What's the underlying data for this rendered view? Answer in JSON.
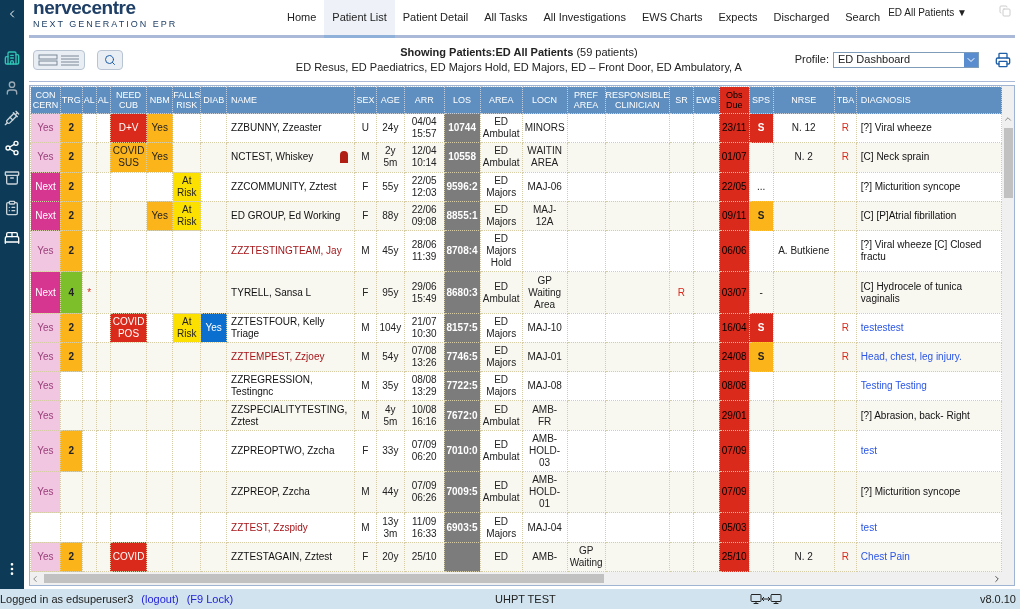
{
  "logo": {
    "name": "nervecentre",
    "tagline": "NEXT GENERATION EPR"
  },
  "nav": [
    {
      "label": "Home",
      "selected": false
    },
    {
      "label": "Patient List",
      "selected": true
    },
    {
      "label": "Patient Detail",
      "selected": false
    },
    {
      "label": "All Tasks",
      "selected": false
    },
    {
      "label": "All Investigations",
      "selected": false
    },
    {
      "label": "EWS Charts",
      "selected": false
    },
    {
      "label": "Expects",
      "selected": false
    },
    {
      "label": "Discharged",
      "selected": false
    },
    {
      "label": "Search",
      "selected": false
    }
  ],
  "list_selector": "ED All Patients ▼",
  "summary": {
    "title": "**Showing Patients:ED All Patients** (59 patients)",
    "areas": "ED Resus, ED Paediatrics, ED Majors Hold, ED Majors, ED – Front Door, ED Ambulatory, A"
  },
  "profile": {
    "label": "Profile:",
    "value": "ED Dashboard"
  },
  "columns": [
    {
      "label": "CON\nCERN"
    },
    {
      "label": "TRG"
    },
    {
      "label": "AL"
    },
    {
      "label": "AL"
    },
    {
      "label": "NEED\nCUB"
    },
    {
      "label": "NBM"
    },
    {
      "label": "FALLS\nRISK"
    },
    {
      "label": "DIAB"
    },
    {
      "label": "NAME",
      "kind": "left"
    },
    {
      "label": "SEX"
    },
    {
      "label": "AGE"
    },
    {
      "label": "ARR"
    },
    {
      "label": "LOS",
      "kind": "shaded"
    },
    {
      "label": "AREA"
    },
    {
      "label": "LOCN"
    },
    {
      "label": "PREF\nAREA"
    },
    {
      "label": "RESPONSIBLE\nCLINICIAN"
    },
    {
      "label": "SR"
    },
    {
      "label": "EWS"
    },
    {
      "label": "Obs\nDue",
      "kind": "alert"
    },
    {
      "label": "SPS"
    },
    {
      "label": "NRSE"
    },
    {
      "label": "TBA"
    },
    {
      "label": "DIAGNOSIS",
      "kind": "left"
    }
  ],
  "rows": [
    {
      "cells": [
        {
          "text": "Yes",
          "color": "#f0c6e0"
        },
        {
          "text": "2",
          "color": "#fbb41a"
        },
        null,
        null,
        {
          "text": "D+V",
          "color": "#d92a1c"
        },
        {
          "text": "Yes",
          "color": "#fbb41a"
        },
        null,
        null,
        {
          "text": "ZZBUNNY, Zzeaster"
        },
        "U",
        "24y",
        "04/04\n15:57",
        "10744",
        "ED\nAmbulat",
        "MINORS",
        null,
        null,
        null,
        null,
        "23/11",
        {
          "text": "S",
          "color": "#d92a1c"
        },
        "N. 12",
        {
          "text": "R",
          "kind": "flag"
        },
        {
          "text": "[?] Viral wheeze"
        }
      ]
    },
    {
      "cells": [
        {
          "text": "Yes",
          "color": "#f0c6e0"
        },
        {
          "text": "2",
          "color": "#fbb41a"
        },
        null,
        null,
        {
          "text": "COVID\nSUS",
          "color": "#fbb41a"
        },
        {
          "text": "Yes",
          "color": "#fbb41a"
        },
        null,
        null,
        {
          "text": "NCTEST, Whiskey",
          "query": true
        },
        "M",
        "2y\n5m",
        "12/04\n10:14",
        "10558",
        "ED\nAmbulat",
        "WAITIN\nAREA",
        null,
        null,
        null,
        null,
        "01/07",
        null,
        "N. 2",
        {
          "text": "R",
          "kind": "flag"
        },
        {
          "text": "[C] Neck sprain"
        }
      ]
    },
    {
      "cells": [
        {
          "text": "Next",
          "color": "#d6368f"
        },
        {
          "text": "2",
          "color": "#fbb41a"
        },
        null,
        null,
        null,
        null,
        {
          "text": "At\nRisk",
          "color": "#fbe000"
        },
        null,
        {
          "text": "ZZCOMMUNITY, Zztest"
        },
        "F",
        "55y",
        "22/05\n12:03",
        "9596:2",
        "ED\nMajors",
        "MAJ-06",
        null,
        null,
        null,
        null,
        "22/05",
        "...",
        null,
        null,
        {
          "text": "[?] Micturition syncope"
        }
      ]
    },
    {
      "cells": [
        {
          "text": "Next",
          "color": "#d6368f"
        },
        {
          "text": "2",
          "color": "#fbb41a"
        },
        null,
        null,
        null,
        {
          "text": "Yes",
          "color": "#fbb41a"
        },
        {
          "text": "At\nRisk",
          "color": "#fbe000"
        },
        null,
        {
          "text": "ED GROUP, Ed Working"
        },
        "F",
        "88y",
        "22/06\n09:08",
        "8855:1",
        "ED\nMajors",
        "MAJ-\n12A",
        null,
        null,
        null,
        null,
        "09/11",
        {
          "text": "S",
          "color": "#fbb41a"
        },
        null,
        null,
        {
          "text": "[C] [P]Atrial fibrillation"
        }
      ]
    },
    {
      "cells": [
        {
          "text": "Yes",
          "color": "#f0c6e0"
        },
        {
          "text": "2",
          "color": "#fbb41a"
        },
        null,
        null,
        null,
        null,
        null,
        null,
        {
          "text": "ZZZTESTINGTEAM, Jay",
          "color": "#a4161a"
        },
        "M",
        "45y",
        "28/06\n11:39",
        "8708:4",
        "ED\nMajors\nHold",
        null,
        null,
        null,
        null,
        null,
        "06/06",
        null,
        "A. Butkiene",
        null,
        {
          "text": "[?] Viral wheeze [C] Closed fractu"
        }
      ]
    },
    {
      "cells": [
        {
          "text": "Next",
          "color": "#d6368f"
        },
        {
          "text": "4",
          "color": "#7cbf2a"
        },
        {
          "text": "*",
          "kind": "flag"
        },
        null,
        null,
        null,
        null,
        null,
        {
          "text": "TYRELL, Sansa L"
        },
        "F",
        "95y",
        "29/06\n15:49",
        "8680:3",
        "ED\nAmbulat",
        "GP\nWaiting\nArea",
        null,
        null,
        {
          "text": "R",
          "kind": "flag"
        },
        null,
        "03/07",
        "-",
        null,
        null,
        {
          "text": "[C] Hydrocele of tunica vaginalis"
        }
      ]
    },
    {
      "cells": [
        {
          "text": "Yes",
          "color": "#f0c6e0"
        },
        {
          "text": "2",
          "color": "#fbb41a"
        },
        null,
        null,
        {
          "text": "COVID\nPOS",
          "color": "#d92a1c"
        },
        null,
        {
          "text": "At\nRisk",
          "color": "#fbe000"
        },
        {
          "text": "Yes",
          "color": "#0b6fd0"
        },
        {
          "text": "ZZTESTFOUR, Kelly Triage"
        },
        "M",
        "104y",
        "21/07\n10:30",
        "8157:5",
        "ED\nMajors",
        "MAJ-10",
        null,
        null,
        null,
        null,
        "16/04",
        {
          "text": "S",
          "color": "#d92a1c"
        },
        null,
        {
          "text": "R",
          "kind": "flag"
        },
        {
          "text": "testestest",
          "kind": "link"
        }
      ]
    },
    {
      "cells": [
        {
          "text": "Yes",
          "color": "#f0c6e0"
        },
        {
          "text": "2",
          "color": "#fbb41a"
        },
        null,
        null,
        null,
        null,
        null,
        null,
        {
          "text": "ZZTEMPEST, Zzjoey",
          "color": "#a4161a"
        },
        "M",
        "54y",
        "07/08\n13:26",
        "7746:5",
        "ED\nMajors",
        "MAJ-01",
        null,
        null,
        null,
        null,
        "24/08",
        {
          "text": "S",
          "color": "#fbb41a"
        },
        null,
        {
          "text": "R",
          "kind": "flag"
        },
        {
          "text": "Head, chest, leg injury.",
          "kind": "link"
        }
      ]
    },
    {
      "cells": [
        {
          "text": "Yes",
          "color": "#f0c6e0"
        },
        null,
        null,
        null,
        null,
        null,
        null,
        null,
        {
          "text": "ZZREGRESSION, Testingnc"
        },
        "M",
        "35y",
        "08/08\n13:29",
        "7722:5",
        "ED\nMajors",
        "MAJ-08",
        null,
        null,
        null,
        null,
        "08/08",
        null,
        null,
        null,
        {
          "text": "Testing Testing",
          "kind": "link"
        }
      ]
    },
    {
      "cells": [
        {
          "text": "Yes",
          "color": "#f0c6e0"
        },
        null,
        null,
        null,
        null,
        null,
        null,
        null,
        {
          "text": "ZZSPECIALITYTESTING, Zztest"
        },
        "M",
        "4y\n5m",
        "10/08\n16:16",
        "7672:0",
        "ED\nAmbulat",
        "AMB-\nFR",
        null,
        null,
        null,
        null,
        "29/01",
        null,
        null,
        null,
        {
          "text": "[?] Abrasion, back- Right"
        }
      ]
    },
    {
      "cells": [
        {
          "text": "Yes",
          "color": "#f0c6e0"
        },
        {
          "text": "2",
          "color": "#fbb41a"
        },
        null,
        null,
        null,
        null,
        null,
        null,
        {
          "text": "ZZPREOPTWO, Zzcha"
        },
        "F",
        "33y",
        "07/09\n06:20",
        "7010:0",
        "ED\nAmbulat",
        "AMB-\nHOLD-\n03",
        null,
        null,
        null,
        null,
        "07/09",
        null,
        null,
        null,
        {
          "text": "test",
          "kind": "link"
        }
      ]
    },
    {
      "cells": [
        {
          "text": "Yes",
          "color": "#f0c6e0"
        },
        null,
        null,
        null,
        null,
        null,
        null,
        null,
        {
          "text": "ZZPREOP, Zzcha"
        },
        "M",
        "44y",
        "07/09\n06:26",
        "7009:5",
        "ED\nAmbulat",
        "AMB-\nHOLD-\n01",
        null,
        null,
        null,
        null,
        "07/09",
        null,
        null,
        null,
        {
          "text": "[?] Micturition syncope"
        }
      ]
    },
    {
      "cells": [
        null,
        null,
        null,
        null,
        null,
        null,
        null,
        null,
        {
          "text": "ZZTEST, Zzspidy",
          "color": "#a4161a"
        },
        "M",
        "13y\n3m",
        "11/09\n16:33",
        "6903:5",
        "ED\nMajors",
        "MAJ-04",
        null,
        null,
        null,
        null,
        "05/03",
        null,
        null,
        null,
        {
          "text": "test",
          "kind": "link"
        }
      ]
    },
    {
      "cells": [
        {
          "text": "Yes",
          "color": "#f0c6e0"
        },
        {
          "text": "2",
          "color": "#fbb41a"
        },
        null,
        null,
        {
          "text": "COVID",
          "color": "#d92a1c"
        },
        null,
        null,
        null,
        {
          "text": "ZZTESTAGAIN, Zztest"
        },
        "F",
        "20y",
        "25/10",
        null,
        "ED",
        "AMB-",
        "GP\nWaiting",
        null,
        null,
        null,
        "25/10",
        null,
        "N. 2",
        {
          "text": "R",
          "kind": "flag"
        },
        {
          "text": "Chest Pain",
          "kind": "link"
        }
      ]
    }
  ],
  "footer": {
    "user": "Logged in as edsuperuser3",
    "logout": "(logout)",
    "lock": "(F9 Lock)",
    "environment": "UHPT TEST",
    "version": "v8.0.10"
  }
}
